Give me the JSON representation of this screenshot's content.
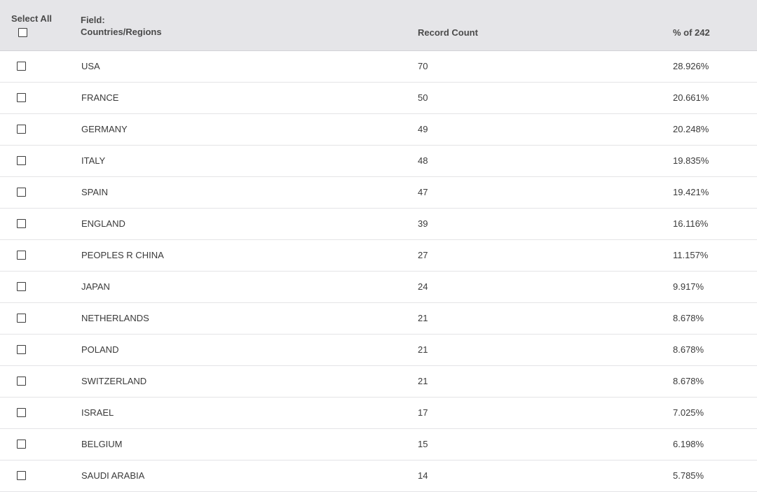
{
  "header": {
    "select_all_label": "Select All",
    "field_label": "Field:",
    "field_name": "Countries/Regions",
    "record_count_label": "Record Count",
    "percent_label": "% of 242"
  },
  "rows": [
    {
      "name": "USA",
      "count": "70",
      "percent": "28.926%"
    },
    {
      "name": "FRANCE",
      "count": "50",
      "percent": "20.661%"
    },
    {
      "name": "GERMANY",
      "count": "49",
      "percent": "20.248%"
    },
    {
      "name": "ITALY",
      "count": "48",
      "percent": "19.835%"
    },
    {
      "name": "SPAIN",
      "count": "47",
      "percent": "19.421%"
    },
    {
      "name": "ENGLAND",
      "count": "39",
      "percent": "16.116%"
    },
    {
      "name": "PEOPLES R CHINA",
      "count": "27",
      "percent": "11.157%"
    },
    {
      "name": "JAPAN",
      "count": "24",
      "percent": "9.917%"
    },
    {
      "name": "NETHERLANDS",
      "count": "21",
      "percent": "8.678%"
    },
    {
      "name": "POLAND",
      "count": "21",
      "percent": "8.678%"
    },
    {
      "name": "SWITZERLAND",
      "count": "21",
      "percent": "8.678%"
    },
    {
      "name": "ISRAEL",
      "count": "17",
      "percent": "7.025%"
    },
    {
      "name": "BELGIUM",
      "count": "15",
      "percent": "6.198%"
    },
    {
      "name": "SAUDI ARABIA",
      "count": "14",
      "percent": "5.785%"
    }
  ]
}
